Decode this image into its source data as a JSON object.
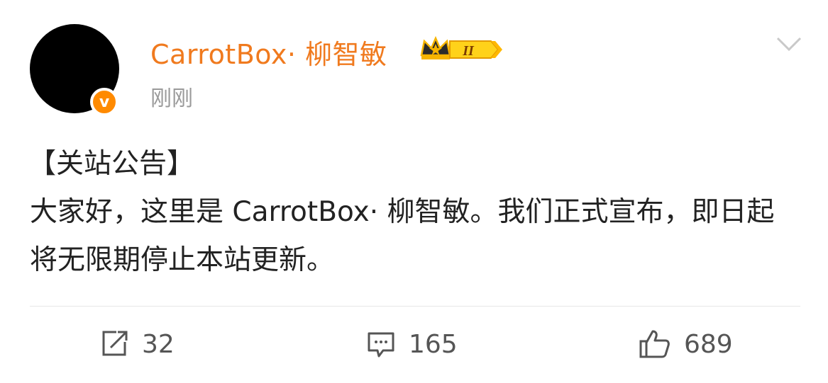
{
  "user": {
    "name": "CarrotBox· 柳智敏",
    "time": "刚刚",
    "verified_icon": "v",
    "level_badge": "II"
  },
  "post": {
    "title": "【关站公告】",
    "body": "大家好，这里是 CarrotBox· 柳智敏。我们正式宣布，即日起将无限期停止本站更新。"
  },
  "actions": {
    "repost_count": "32",
    "comment_count": "165",
    "like_count": "689"
  },
  "colors": {
    "username": "#f07a1e",
    "timestamp": "#9a9a9a",
    "verified_badge": "#ff8a00",
    "vip_gold": "#f5b400"
  }
}
